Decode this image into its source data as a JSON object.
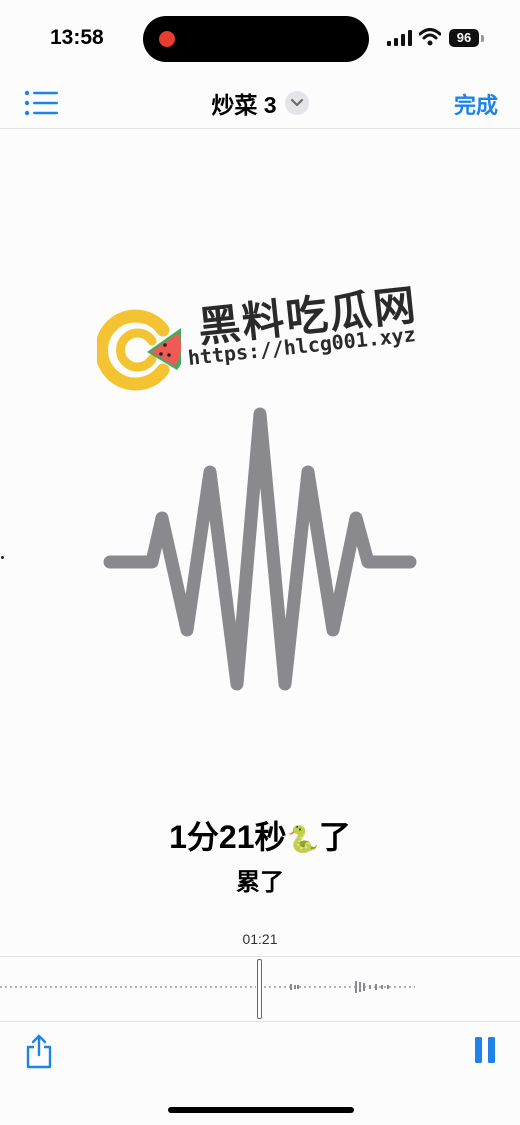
{
  "status_bar": {
    "time": "13:58",
    "battery": "96"
  },
  "nav": {
    "title": "炒菜 3",
    "done_label": "完成"
  },
  "watermark": {
    "title": "黑料吃瓜网",
    "url": "https://hlcg001.xyz"
  },
  "caption": {
    "main": "1分21秒",
    "emoji": "🐍",
    "main_suffix": "了",
    "sub": "累了"
  },
  "timeline": {
    "timestamp": "01:21"
  },
  "colors": {
    "accent": "#1f82e8",
    "waveform": "#8a898e",
    "record": "#ea3b30"
  }
}
